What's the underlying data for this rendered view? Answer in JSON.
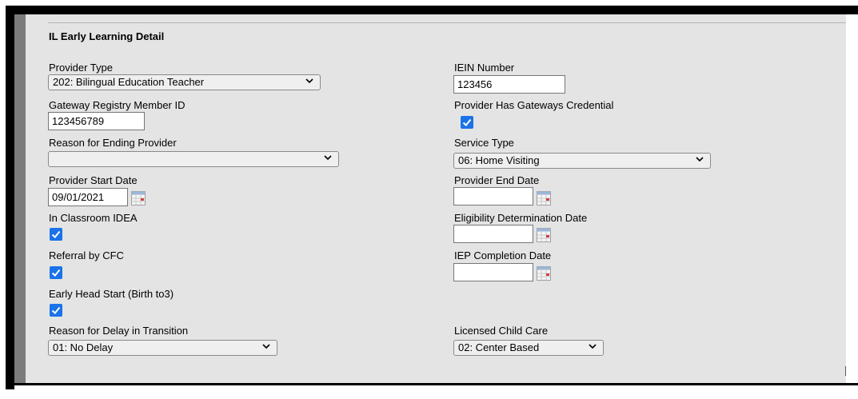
{
  "section": {
    "title": "IL Early Learning Detail"
  },
  "fields": {
    "provider_type": {
      "label": "Provider Type",
      "value": "202: Bilingual Education Teacher"
    },
    "iein_number": {
      "label": "IEIN Number",
      "value": "123456"
    },
    "gateway_id": {
      "label": "Gateway Registry Member ID",
      "value": "123456789"
    },
    "gateways_credential": {
      "label": "Provider Has Gateways Credential",
      "checked": true
    },
    "reason_ending": {
      "label": "Reason for Ending Provider",
      "value": ""
    },
    "service_type": {
      "label": "Service Type",
      "value": "06: Home Visiting"
    },
    "start_date": {
      "label": "Provider Start Date",
      "value": "09/01/2021"
    },
    "end_date": {
      "label": "Provider End Date",
      "value": ""
    },
    "in_classroom_idea": {
      "label": "In Classroom IDEA",
      "checked": true
    },
    "eligibility_date": {
      "label": "Eligibility Determination Date",
      "value": ""
    },
    "referral_cfc": {
      "label": "Referral by CFC",
      "checked": true
    },
    "iep_completion_date": {
      "label": "IEP Completion Date",
      "value": ""
    },
    "early_head_start": {
      "label": "Early Head Start (Birth to3)",
      "checked": true
    },
    "reason_delay": {
      "label": "Reason for Delay in Transition",
      "value": "01: No Delay"
    },
    "licensed_child_care": {
      "label": "Licensed Child Care",
      "value": "02: Center Based"
    }
  },
  "icons": {
    "dropdown": "chevron-down-icon",
    "calendar": "calendar-icon",
    "check": "checkmark-icon"
  },
  "colors": {
    "panel": "#e4e4e4",
    "checkbox": "#1a73e8",
    "sidebar": "#7b7b7b"
  }
}
